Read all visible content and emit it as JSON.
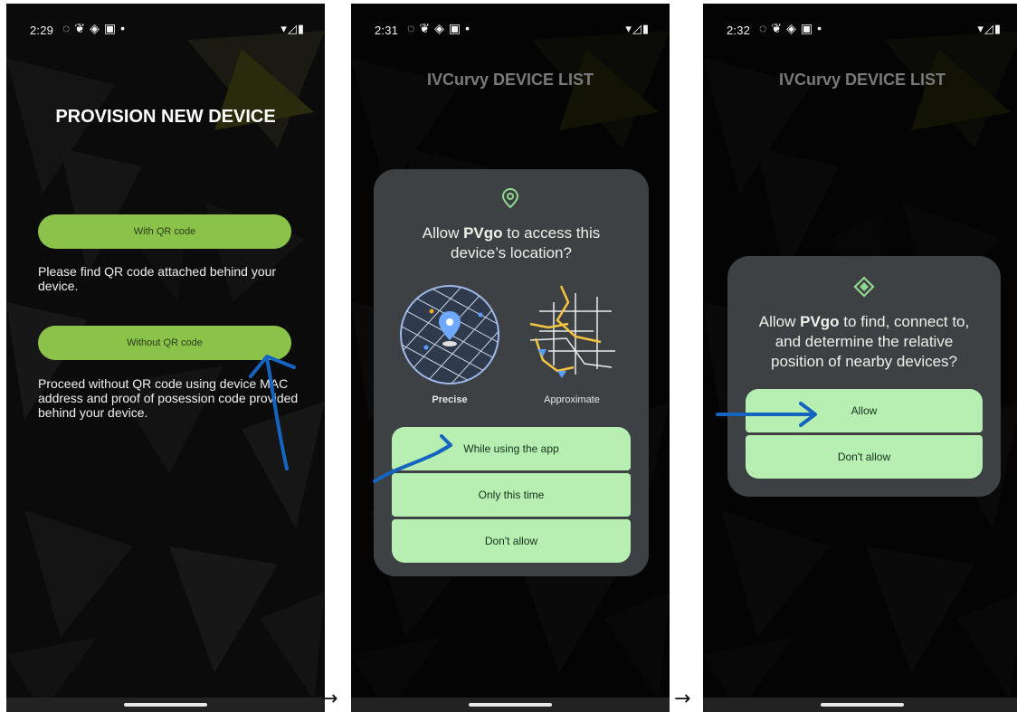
{
  "screens": [
    {
      "status": {
        "time": "2:29",
        "system_icons": "▾◿▮"
      },
      "title": "PROVISION NEW DEVICE",
      "qr_button": "With QR code",
      "qr_description": "Please find QR code attached behind your device.",
      "no_qr_button": "Without QR code",
      "no_qr_description": "Proceed without QR code using device MAC address and proof of posession code provided behind your device."
    },
    {
      "status": {
        "time": "2:31",
        "system_icons": "▾◿▮"
      },
      "title": "IVCurvy DEVICE LIST",
      "dialog": {
        "icon": "location-pin-icon",
        "question_prefix": "Allow ",
        "app_name": "PVgo",
        "question_suffix": " to access this device’s location?",
        "precise_label": "Precise",
        "approximate_label": "Approximate",
        "buttons": [
          "While using the app",
          "Only this time",
          "Don't allow"
        ]
      }
    },
    {
      "status": {
        "time": "2:32",
        "system_icons": "▾◿▮"
      },
      "title": "IVCurvy DEVICE LIST",
      "dialog": {
        "icon": "nearby-devices-icon",
        "question_prefix": "Allow ",
        "app_name": "PVgo",
        "question_suffix": " to find, connect to, and determine the relative position of nearby devices?",
        "buttons": [
          "Allow",
          "Don't allow"
        ]
      }
    }
  ],
  "separators": [
    "→",
    "→"
  ],
  "colors": {
    "accent_green": "#8bc34a",
    "permission_button": "#b7efb3",
    "dialog_bg": "#3e4143",
    "annotation_blue": "#1565c0"
  }
}
